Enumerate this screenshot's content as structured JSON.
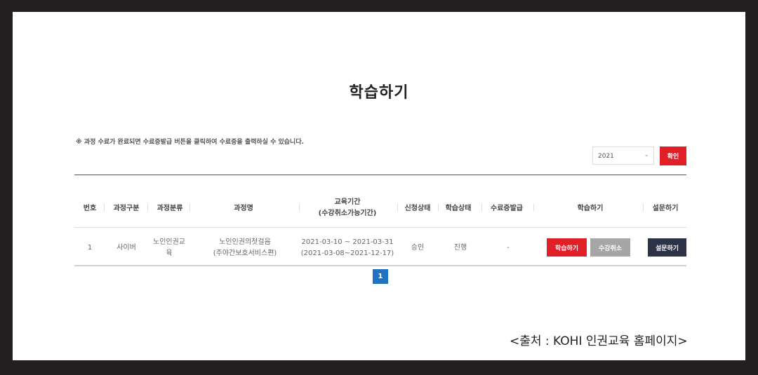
{
  "page_title": "학습하기",
  "notice": "※ 과정 수료가 완료되면 수료증발급 버튼을 클릭하여 수료증을 출력하실 수 있습니다.",
  "filter": {
    "year": "2021",
    "confirm_label": "확인"
  },
  "table": {
    "headers": [
      "번호",
      "과정구분",
      "과정분류",
      "과정명",
      "교육기간",
      "(수강취소가능기간)",
      "신청상태",
      "학습상태",
      "수료증발급",
      "학습하기",
      "설문하기"
    ],
    "row": {
      "number": "1",
      "course_type": "사이버",
      "category_1": "노인인권교",
      "category_2": "육",
      "course_name_1": "노인인권의첫걸음",
      "course_name_2": "(주야간보호서비스편)",
      "period": "2021-03-10 ~ 2021-03-31",
      "cancel_period": "(2021-03-08~2021-12-17)",
      "apply_status": "승인",
      "study_status": "진행",
      "certificate": "-",
      "study_button": "학습하기",
      "cancel_button": "수강취소",
      "survey_button": "설문하기"
    }
  },
  "pagination": {
    "current_page": "1"
  },
  "source_caption": "<출처 : KOHI 인권교육  홈페이지>",
  "colors": {
    "accent_red": "#e01f26",
    "page_blue": "#1f74c2",
    "survey_navy": "#2c3346",
    "frame": "#231f20"
  }
}
